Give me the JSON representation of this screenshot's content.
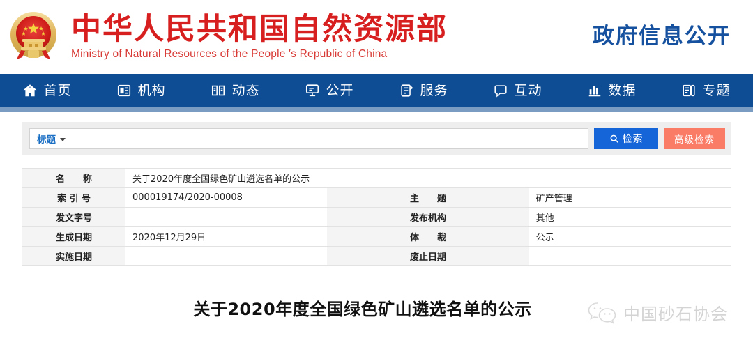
{
  "header": {
    "emblem_icon": "national-emblem-icon",
    "brand_cn": "中华人民共和国自然资源部",
    "brand_en": "Ministry of Natural Resources of the People ′s Republic of China",
    "gov_open_label": "政府信息公开",
    "brand_color": "#d81f20",
    "gov_open_color": "#15519e"
  },
  "nav": {
    "background_color": "#0e4d94",
    "underline_color": "#7a9cc2",
    "items": [
      {
        "label": "首页",
        "icon": "home-icon"
      },
      {
        "label": "机构",
        "icon": "organization-icon"
      },
      {
        "label": "动态",
        "icon": "news-book-icon"
      },
      {
        "label": "公开",
        "icon": "disclosure-monitor-icon"
      },
      {
        "label": "服务",
        "icon": "service-clipboard-icon"
      },
      {
        "label": "互动",
        "icon": "interaction-chat-icon"
      },
      {
        "label": "数据",
        "icon": "data-bar-chart-icon"
      },
      {
        "label": "专题",
        "icon": "topic-book-icon"
      }
    ]
  },
  "search": {
    "panel_background": "#eeeeee",
    "category_label": "标题",
    "category_caret": "chevron-down-icon",
    "keyword_value": "",
    "keyword_placeholder": "",
    "search_button_label": "检索",
    "search_button_icon": "search-icon",
    "search_button_color": "#1565d8",
    "advanced_button_label": "高级检索",
    "advanced_button_color": "#fa7b66"
  },
  "info_table": {
    "rows": [
      {
        "left_label": "名　　称",
        "left_value": "关于2020年度全国绿色矿山遴选名单的公示",
        "full_width": true
      },
      {
        "left_label": "索 引 号",
        "left_value": "000019174/2020-00008",
        "right_label": "主　　题",
        "right_value": "矿产管理"
      },
      {
        "left_label": "发文字号",
        "left_value": "",
        "right_label": "发布机构",
        "right_value": "其他"
      },
      {
        "left_label": "生成日期",
        "left_value": "2020年12月29日",
        "right_label": "体　　裁",
        "right_value": "公示"
      },
      {
        "left_label": "实施日期",
        "left_value": "",
        "right_label": "废止日期",
        "right_value": ""
      }
    ]
  },
  "document": {
    "title": "关于2020年度全国绿色矿山遴选名单的公示"
  },
  "watermark": {
    "icon": "wechat-icon",
    "text": "中国砂石协会"
  }
}
